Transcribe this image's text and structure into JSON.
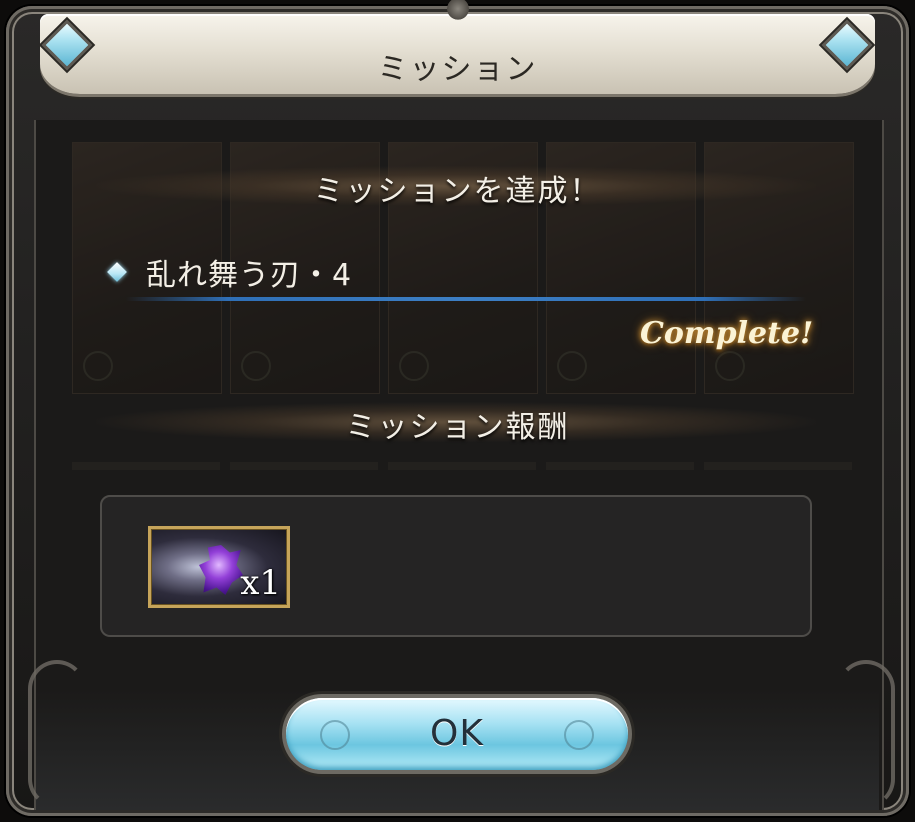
{
  "dialog": {
    "title": "ミッション"
  },
  "achievement": {
    "heading": "ミッションを達成！",
    "mission_name": "乱れ舞う刃・4",
    "status": "Complete!"
  },
  "reward": {
    "heading": "ミッション報酬",
    "items": [
      {
        "icon": "purple-crystal-icon",
        "quantity": "x1"
      }
    ]
  },
  "actions": {
    "ok_label": "OK"
  },
  "colors": {
    "header_bg": "#e4dfd2",
    "panel_bg": "#1b1a19",
    "progress_line": "#3d7fc4",
    "complete_glow": "#d39a3c",
    "ok_button": "#a7e2f3"
  }
}
